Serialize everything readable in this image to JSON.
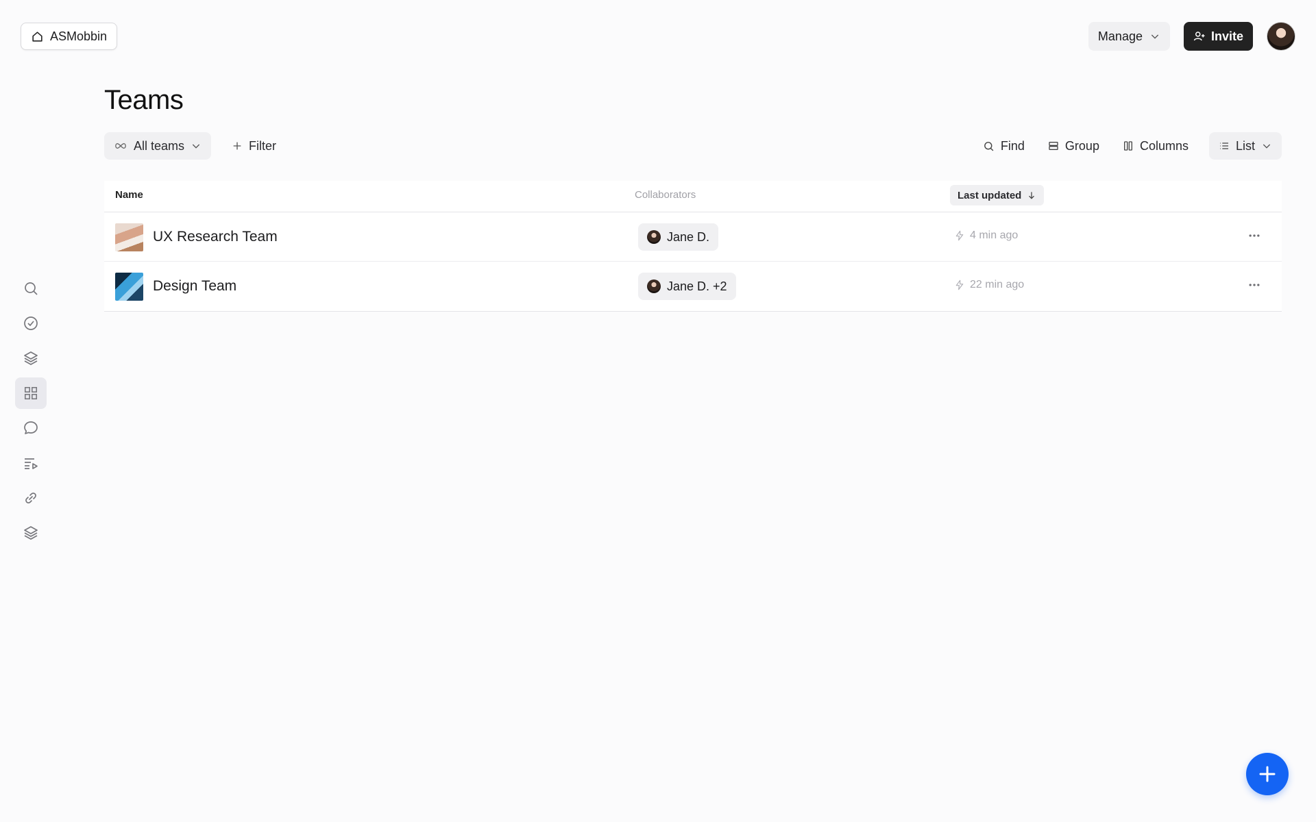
{
  "header": {
    "workspace_name": "ASMobbin",
    "manage_label": "Manage",
    "invite_label": "Invite"
  },
  "page": {
    "title": "Teams"
  },
  "toolbar": {
    "all_teams_label": "All teams",
    "filter_label": "Filter",
    "find_label": "Find",
    "group_label": "Group",
    "columns_label": "Columns",
    "view_label": "List"
  },
  "table": {
    "columns": {
      "name": "Name",
      "collaborators": "Collaborators",
      "last_updated": "Last updated"
    },
    "rows": [
      {
        "name": "UX Research Team",
        "collaborators": "Jane D.",
        "updated": "4 min ago"
      },
      {
        "name": "Design Team",
        "collaborators": "Jane D. +2",
        "updated": "22 min ago"
      }
    ]
  },
  "sidebar": {
    "icons": [
      "search-icon",
      "check-circle-icon",
      "layers-icon",
      "grid-icon",
      "chat-icon",
      "playlist-icon",
      "link-icon",
      "stack-icon"
    ],
    "active": "grid-icon"
  },
  "colors": {
    "accent": "#1464f4",
    "invite_bg": "#222222"
  }
}
